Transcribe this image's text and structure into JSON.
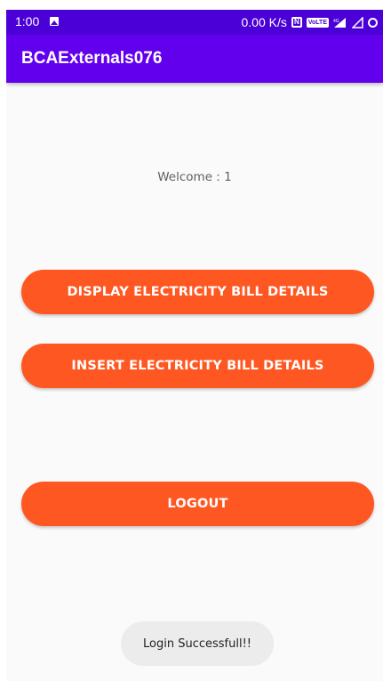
{
  "status_bar": {
    "time": "1:00",
    "network_speed": "0.00 K/s",
    "icons": {
      "gallery": "image-icon",
      "nfc": "nfc-icon",
      "volte": "VoLTE",
      "signal": "signal-4g-icon",
      "signal_empty": "signal-empty-icon",
      "battery": "battery-icon"
    },
    "colors": {
      "background": "#4a00d6"
    }
  },
  "app_bar": {
    "title": "BCAExternals076",
    "color": "#6200ee"
  },
  "main": {
    "welcome_text": "Welcome : 1",
    "buttons": {
      "display": "DISPLAY ELECTRICITY BILL DETAILS",
      "insert": "INSERT ELECTRICITY BILL DETAILS",
      "logout": "LOGOUT"
    },
    "button_color": "#ff5722"
  },
  "toast": {
    "message": "Login Successfull!!"
  }
}
